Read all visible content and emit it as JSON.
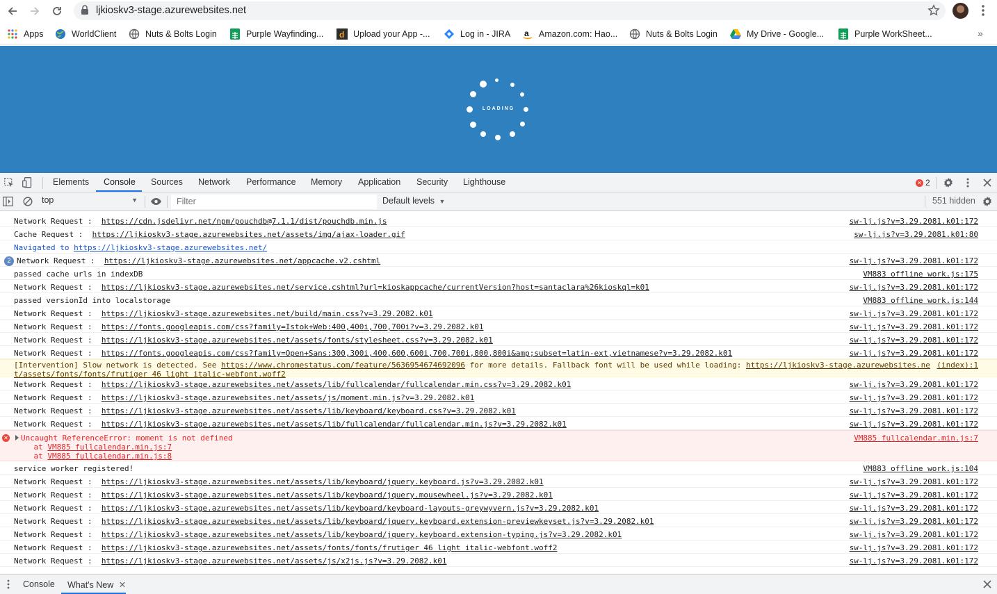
{
  "browser": {
    "url": "ljkioskv3-stage.azurewebsites.net"
  },
  "bookmarks": [
    {
      "label": "Apps",
      "icon": "apps-grid-icon"
    },
    {
      "label": "WorldClient",
      "icon": "globe-icon"
    },
    {
      "label": "Nuts & Bolts Login",
      "icon": "globe-icon"
    },
    {
      "label": "Purple Wayfinding...",
      "icon": "sheets-icon"
    },
    {
      "label": "Upload your App -...",
      "icon": "d-icon"
    },
    {
      "label": "Log in - JIRA",
      "icon": "jira-icon"
    },
    {
      "label": "Amazon.com: Hao...",
      "icon": "amazon-icon"
    },
    {
      "label": "Nuts & Bolts Login",
      "icon": "globe-icon"
    },
    {
      "label": "My Drive - Google...",
      "icon": "drive-icon"
    },
    {
      "label": "Purple WorkSheet...",
      "icon": "sheets-icon"
    }
  ],
  "page": {
    "loading_text": "LOADING",
    "background": "#2f80be"
  },
  "devtools": {
    "tabs": [
      "Elements",
      "Console",
      "Sources",
      "Network",
      "Performance",
      "Memory",
      "Application",
      "Security",
      "Lighthouse"
    ],
    "active_tab": "Console",
    "error_count": "2",
    "context": "top",
    "filter_placeholder": "Filter",
    "levels": "Default levels",
    "hidden": "551 hidden",
    "drawer_tabs": [
      "Console",
      "What's New"
    ]
  },
  "console": [
    {
      "kind": "log",
      "prefix": "Network Request :  ",
      "link": "https://cdn.jsdelivr.net/npm/pouchdb@7.1.1/dist/pouchdb.min.js",
      "suffix": "",
      "source": "sw-lj.js?v=3.29.2081.k01:172"
    },
    {
      "kind": "log",
      "prefix": "Cache Request :  ",
      "link": "https://ljkioskv3-stage.azurewebsites.net/assets/img/ajax-loader.gif",
      "suffix": "",
      "source": "sw-lj.js?v=3.29.2081.k01:80"
    },
    {
      "kind": "nav",
      "prefix": "Navigated to ",
      "link": "https://ljkioskv3-stage.azurewebsites.net/",
      "suffix": "",
      "source": ""
    },
    {
      "kind": "repeat",
      "count": "2",
      "prefix": "Network Request :  ",
      "link": "https://ljkioskv3-stage.azurewebsites.net/appcache.v2.cshtml",
      "suffix": "",
      "source": "sw-lj.js?v=3.29.2081.k01:172"
    },
    {
      "kind": "log",
      "prefix": "passed cache urls in indexDB",
      "link": "",
      "suffix": "",
      "source": "VM883 offline work.js:175"
    },
    {
      "kind": "log",
      "prefix": "Network Request :  ",
      "link": "https://ljkioskv3-stage.azurewebsites.net/service.cshtml?url=kioskappcache/currentVersion?host=santaclara%26kioskql=k01",
      "suffix": "",
      "source": "sw-lj.js?v=3.29.2081.k01:172"
    },
    {
      "kind": "log",
      "prefix": "passed versionId into localstorage",
      "link": "",
      "suffix": "",
      "source": "VM883 offline work.js:144"
    },
    {
      "kind": "log",
      "prefix": "Network Request :  ",
      "link": "https://ljkioskv3-stage.azurewebsites.net/build/main.css?v=3.29.2082.k01",
      "suffix": "",
      "source": "sw-lj.js?v=3.29.2081.k01:172"
    },
    {
      "kind": "log",
      "prefix": "Network Request :  ",
      "link": "https://fonts.googleapis.com/css?family=Istok+Web:400,400i,700,700i?v=3.29.2082.k01",
      "suffix": "",
      "source": "sw-lj.js?v=3.29.2081.k01:172"
    },
    {
      "kind": "log",
      "prefix": "Network Request :  ",
      "link": "https://ljkioskv3-stage.azurewebsites.net/assets/fonts/stylesheet.css?v=3.29.2082.k01",
      "suffix": "",
      "source": "sw-lj.js?v=3.29.2081.k01:172"
    },
    {
      "kind": "log",
      "prefix": "Network Request :  ",
      "link": "https://fonts.googleapis.com/css?family=Open+Sans:300,300i,400,600,600i,700,700i,800,800i&amp;subset=latin-ext,vietnamese?v=3.29.2082.k01",
      "suffix": "",
      "source": "sw-lj.js?v=3.29.2081.k01:172"
    },
    {
      "kind": "warn",
      "prefix": "[Intervention] Slow network is detected. See ",
      "link": "https://www.chromestatus.com/feature/5636954674692096",
      "suffix": " for more details. Fallback font will be used while loading: ",
      "link2": "https://ljkioskv3-stage.azurewebsites.ne",
      "line2": "t/assets/fonts/fonts/frutiger 46 light italic-webfont.woff2",
      "source": "(index):1"
    },
    {
      "kind": "log",
      "prefix": "Network Request :  ",
      "link": "https://ljkioskv3-stage.azurewebsites.net/assets/lib/fullcalendar/fullcalendar.min.css?v=3.29.2082.k01",
      "suffix": "",
      "source": "sw-lj.js?v=3.29.2081.k01:172"
    },
    {
      "kind": "log",
      "prefix": "Network Request :  ",
      "link": "https://ljkioskv3-stage.azurewebsites.net/assets/js/moment.min.js?v=3.29.2082.k01",
      "suffix": "",
      "source": "sw-lj.js?v=3.29.2081.k01:172"
    },
    {
      "kind": "log",
      "prefix": "Network Request :  ",
      "link": "https://ljkioskv3-stage.azurewebsites.net/assets/lib/keyboard/keyboard.css?v=3.29.2082.k01",
      "suffix": "",
      "source": "sw-lj.js?v=3.29.2081.k01:172"
    },
    {
      "kind": "log",
      "prefix": "Network Request :  ",
      "link": "https://ljkioskv3-stage.azurewebsites.net/assets/lib/fullcalendar/fullcalendar.min.js?v=3.29.2082.k01",
      "suffix": "",
      "source": "sw-lj.js?v=3.29.2081.k01:172"
    },
    {
      "kind": "error",
      "prefix": "Uncaught ReferenceError: moment is not defined",
      "stack": [
        {
          "at": "    at ",
          "link": "VM885 fullcalendar.min.js:7"
        },
        {
          "at": "    at ",
          "link": "VM885 fullcalendar.min.js:8"
        }
      ],
      "source": "VM885 fullcalendar.min.js:7"
    },
    {
      "kind": "log",
      "prefix": "service worker registered!",
      "link": "",
      "suffix": "",
      "source": "VM883 offline work.js:104"
    },
    {
      "kind": "log",
      "prefix": "Network Request :  ",
      "link": "https://ljkioskv3-stage.azurewebsites.net/assets/lib/keyboard/jquery.keyboard.js?v=3.29.2082.k01",
      "suffix": "",
      "source": "sw-lj.js?v=3.29.2081.k01:172"
    },
    {
      "kind": "log",
      "prefix": "Network Request :  ",
      "link": "https://ljkioskv3-stage.azurewebsites.net/assets/lib/keyboard/jquery.mousewheel.js?v=3.29.2082.k01",
      "suffix": "",
      "source": "sw-lj.js?v=3.29.2081.k01:172"
    },
    {
      "kind": "log",
      "prefix": "Network Request :  ",
      "link": "https://ljkioskv3-stage.azurewebsites.net/assets/lib/keyboard/keyboard-layouts-greywyvern.js?v=3.29.2082.k01",
      "suffix": "",
      "source": "sw-lj.js?v=3.29.2081.k01:172"
    },
    {
      "kind": "log",
      "prefix": "Network Request :  ",
      "link": "https://ljkioskv3-stage.azurewebsites.net/assets/lib/keyboard/jquery.keyboard.extension-previewkeyset.js?v=3.29.2082.k01",
      "suffix": "",
      "source": "sw-lj.js?v=3.29.2081.k01:172"
    },
    {
      "kind": "log",
      "prefix": "Network Request :  ",
      "link": "https://ljkioskv3-stage.azurewebsites.net/assets/lib/keyboard/jquery.keyboard.extension-typing.js?v=3.29.2082.k01",
      "suffix": "",
      "source": "sw-lj.js?v=3.29.2081.k01:172"
    },
    {
      "kind": "log",
      "prefix": "Network Request :  ",
      "link": "https://ljkioskv3-stage.azurewebsites.net/assets/fonts/fonts/frutiger 46 light italic-webfont.woff2",
      "suffix": "",
      "source": "sw-lj.js?v=3.29.2081.k01:172"
    },
    {
      "kind": "log",
      "prefix": "Network Request :  ",
      "link": "https://ljkioskv3-stage.azurewebsites.net/assets/js/x2js.js?v=3.29.2082.k01",
      "suffix": "",
      "source": "sw-lj.js?v=3.29.2081.k01:172"
    }
  ]
}
